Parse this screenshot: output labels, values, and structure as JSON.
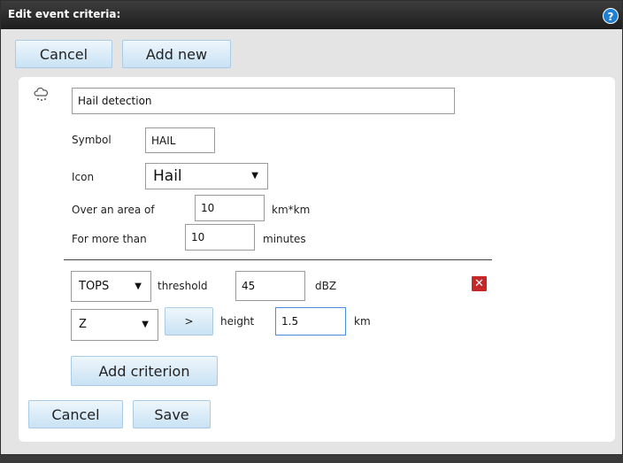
{
  "dialog": {
    "title": "Edit event criteria:",
    "help_glyph": "?",
    "top_cancel": "Cancel",
    "add_new": "Add new"
  },
  "event": {
    "name": "Hail detection",
    "symbol_label": "Symbol",
    "symbol_value": "HAIL",
    "icon_label": "Icon",
    "icon_value": "Hail",
    "area_label": "Over an area of",
    "area_value": "10",
    "area_unit": "km*km",
    "duration_label": "For more than",
    "duration_value": "10",
    "duration_unit": "minutes"
  },
  "criterion": {
    "product_value": "TOPS",
    "threshold_label": "threshold",
    "threshold_value": "45",
    "threshold_unit": "dBZ",
    "remove_glyph": "✕",
    "quantity_value": "Z",
    "operator_label": ">",
    "height_label": "height",
    "height_value": "1.5",
    "height_unit": "km"
  },
  "actions": {
    "add_criterion": "Add criterion",
    "bottom_cancel": "Cancel",
    "save": "Save"
  },
  "dropdown_arrow": "▼",
  "colors": {
    "titlebar": "#1e1e1e",
    "button_accent": "#c9e2f4",
    "remove": "#c62828",
    "help": "#1e7fd3"
  }
}
